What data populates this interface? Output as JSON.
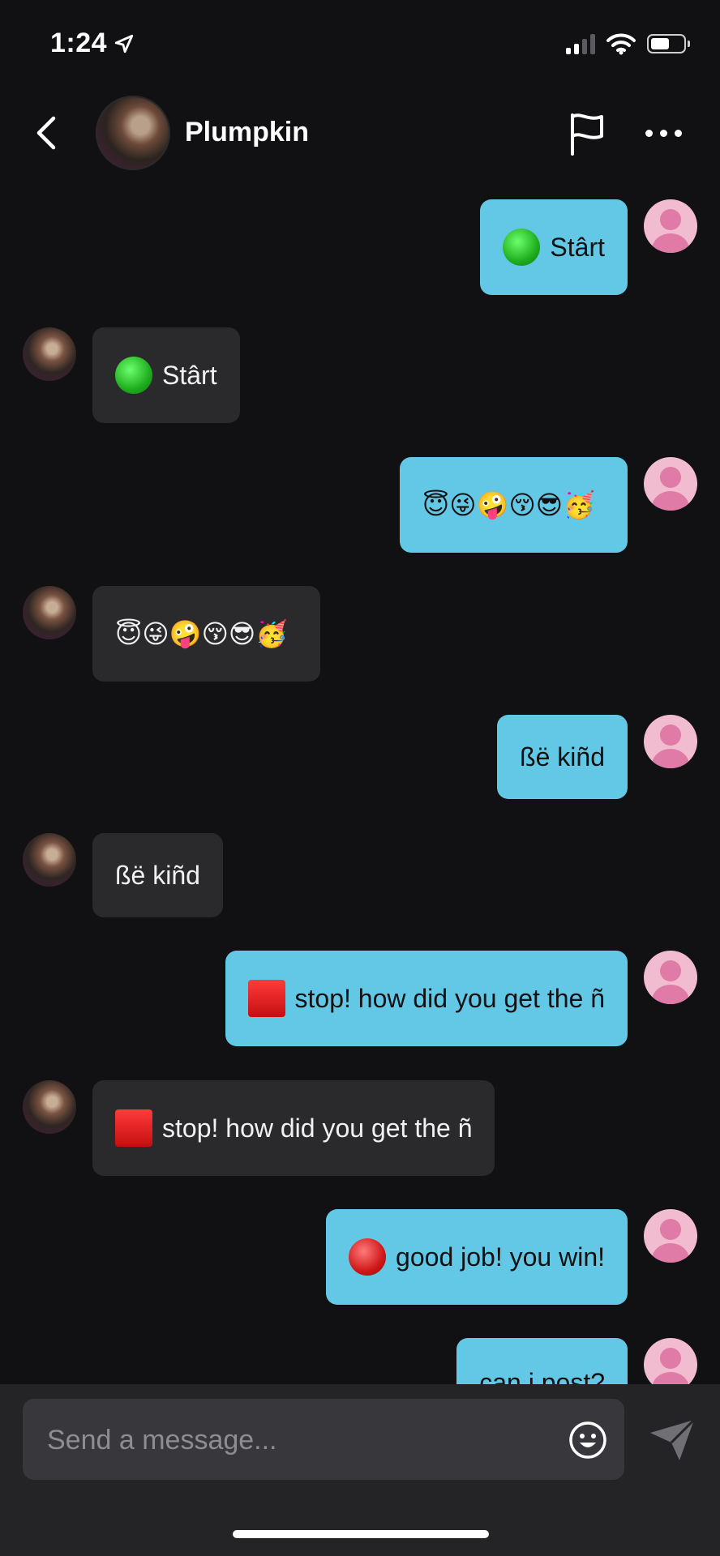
{
  "status": {
    "time": "1:24"
  },
  "header": {
    "name": "Plumpkin"
  },
  "messages": [
    {
      "side": "me",
      "lead": "green-circle",
      "text": "Stârt"
    },
    {
      "side": "them",
      "lead": "green-circle",
      "text": "Stârt"
    },
    {
      "side": "me",
      "lead": "emoji-row",
      "text": "😇😜🤪😚😎🥳"
    },
    {
      "side": "them",
      "lead": "emoji-row",
      "text": "😇😜🤪😚😎🥳"
    },
    {
      "side": "me",
      "lead": "",
      "text": "ßë kiñd"
    },
    {
      "side": "them",
      "lead": "",
      "text": "ßë kiñd"
    },
    {
      "side": "me",
      "lead": "red-square",
      "text": "stop! how did you get the ñ"
    },
    {
      "side": "them",
      "lead": "red-square",
      "text": "stop! how did you get the ñ"
    },
    {
      "side": "me",
      "lead": "red-circle",
      "text": "good job! you win!"
    },
    {
      "side": "me",
      "lead": "",
      "text": "can i post?"
    }
  ],
  "composer": {
    "placeholder": "Send a message..."
  }
}
